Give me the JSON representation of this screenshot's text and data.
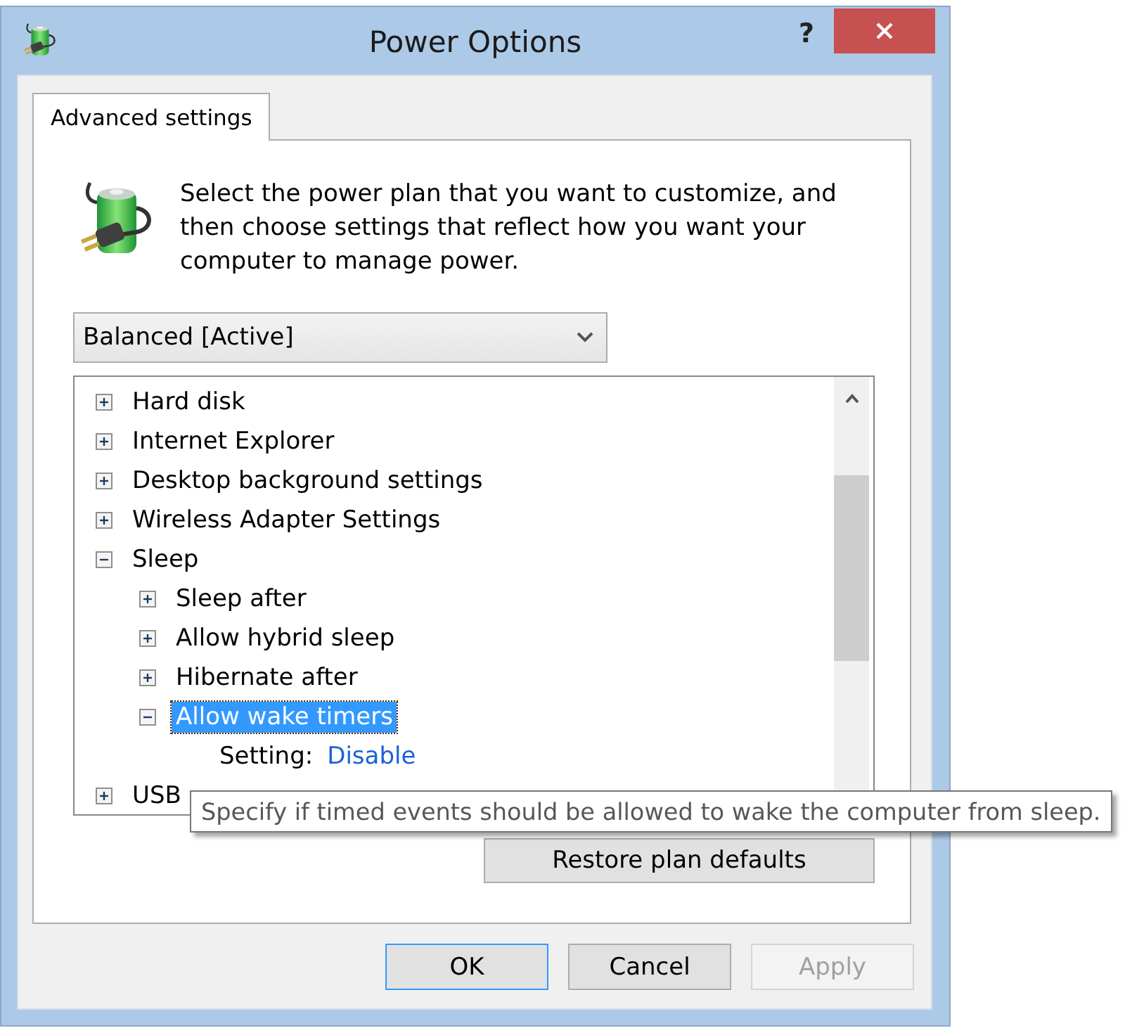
{
  "window": {
    "title": "Power Options",
    "help_button": "?"
  },
  "tabs": [
    {
      "label": "Advanced settings",
      "selected": true
    }
  ],
  "intro": {
    "text": "Select the power plan that you want to customize, and then choose settings that reflect how you want your computer to manage power."
  },
  "plan_dropdown": {
    "value": "Balanced [Active]"
  },
  "settings_tree": {
    "items": [
      {
        "kind": "node",
        "label": "Hard disk",
        "expanded": false,
        "selected": false
      },
      {
        "kind": "node",
        "label": "Internet Explorer",
        "expanded": false,
        "selected": false
      },
      {
        "kind": "node",
        "label": "Desktop background settings",
        "expanded": false,
        "selected": false
      },
      {
        "kind": "node",
        "label": "Wireless Adapter Settings",
        "expanded": false,
        "selected": false
      },
      {
        "kind": "node",
        "label": "Sleep",
        "expanded": true,
        "selected": false,
        "children": [
          {
            "kind": "node",
            "label": "Sleep after",
            "expanded": false,
            "selected": false
          },
          {
            "kind": "node",
            "label": "Allow hybrid sleep",
            "expanded": false,
            "selected": false
          },
          {
            "kind": "node",
            "label": "Hibernate after",
            "expanded": false,
            "selected": false
          },
          {
            "kind": "node",
            "label": "Allow wake timers",
            "expanded": true,
            "selected": true,
            "children": [
              {
                "kind": "setting",
                "label": "Setting:",
                "value": "Disable",
                "selected": false
              }
            ]
          }
        ]
      },
      {
        "kind": "node",
        "label": "USB",
        "expanded": false,
        "selected": false
      }
    ]
  },
  "tooltip": {
    "text": "Specify if timed events should be allowed to wake the computer from sleep."
  },
  "restore_button": {
    "label": "Restore plan defaults"
  },
  "buttons": [
    {
      "label": "OK",
      "default": true,
      "disabled": false
    },
    {
      "label": "Cancel",
      "default": false,
      "disabled": false
    },
    {
      "label": "Apply",
      "default": false,
      "disabled": true
    }
  ]
}
